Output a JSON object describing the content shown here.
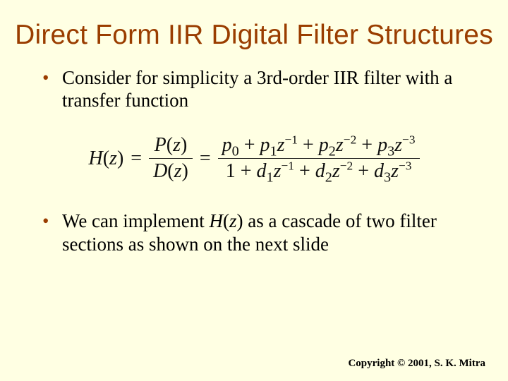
{
  "title": "Direct Form IIR Digital Filter Structures",
  "bullet1": "Consider for simplicity a 3rd-order IIR filter with a transfer function",
  "bullet2_pre": "We can implement ",
  "bullet2_H": "H",
  "bullet2_paren_open": "(",
  "bullet2_z": "z",
  "bullet2_paren_close": ")",
  "bullet2_post": " as a cascade of two filter sections as shown on the next slide",
  "formula": {
    "lhs_H": "H",
    "lhs_paren_open": "(",
    "lhs_z": "z",
    "lhs_paren_close": ")",
    "eq1": "=",
    "mid_num_P": "P",
    "mid_num_po": "(",
    "mid_num_z": "z",
    "mid_num_pc": ")",
    "mid_den_D": "D",
    "mid_den_po": "(",
    "mid_den_z": "z",
    "mid_den_pc": ")",
    "eq2": "=",
    "num_p0": "p",
    "num_p0_sub": "0",
    "plus1": " + ",
    "num_p1": "p",
    "num_p1_sub": "1",
    "num_z1": "z",
    "num_z1_sup": "−1",
    "plus2": " + ",
    "num_p2": "p",
    "num_p2_sub": "2",
    "num_z2": "z",
    "num_z2_sup": "−2",
    "plus3": " + ",
    "num_p3": "p",
    "num_p3_sub": "3",
    "num_z3": "z",
    "num_z3_sup": "−3",
    "den_1": "1",
    "dplus1": " + ",
    "den_d1": "d",
    "den_d1_sub": "1",
    "den_z1": "z",
    "den_z1_sup": "−1",
    "dplus2": " + ",
    "den_d2": "d",
    "den_d2_sub": "2",
    "den_z2": "z",
    "den_z2_sup": "−2",
    "dplus3": " + ",
    "den_d3": "d",
    "den_d3_sub": "3",
    "den_z3": "z",
    "den_z3_sup": "−3"
  },
  "copyright": "Copyright © 2001, S. K. Mitra"
}
